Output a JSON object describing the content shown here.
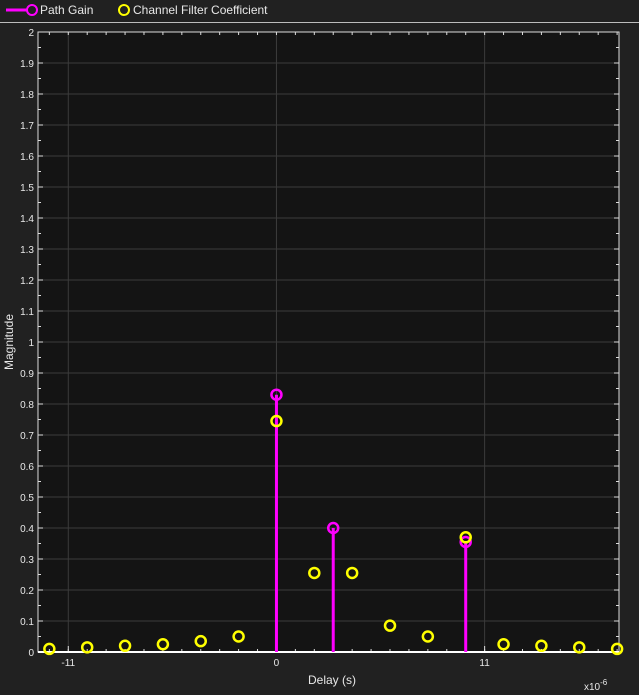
{
  "chart_data": {
    "type": "scatter",
    "title": "",
    "xlabel": "Delay (s)",
    "ylabel": "Magnitude",
    "x_exponent_label": "x10",
    "x_exponent": "-6",
    "xlim": [
      -12.6,
      18.1
    ],
    "ylim": [
      0,
      2
    ],
    "xticks": [
      -11,
      0,
      11
    ],
    "yticks": [
      "0",
      "0.1",
      "0.2",
      "0.3",
      "0.4",
      "0.5",
      "0.6",
      "0.7",
      "0.8",
      "0.9",
      "1",
      "1.1",
      "1.2",
      "1.3",
      "1.4",
      "1.5",
      "1.6",
      "1.7",
      "1.8",
      "1.9",
      "2"
    ],
    "grid": true,
    "legend_placement": "top",
    "series": [
      {
        "name": "Path Gain",
        "style": "stem",
        "color": "#ff00ff",
        "x": [
          0,
          3,
          10
        ],
        "y": [
          0.83,
          0.4,
          0.355
        ]
      },
      {
        "name": "Channel Filter Coefficient",
        "style": "marker",
        "color": "#ffff00",
        "x": [
          -12,
          -10,
          -8,
          -6,
          -4,
          -2,
          0,
          2,
          4,
          6,
          8,
          10,
          12,
          14,
          16,
          18
        ],
        "y": [
          0.01,
          0.015,
          0.02,
          0.025,
          0.035,
          0.05,
          0.745,
          0.255,
          0.255,
          0.085,
          0.05,
          0.37,
          0.025,
          0.02,
          0.015,
          0.01
        ]
      }
    ]
  }
}
